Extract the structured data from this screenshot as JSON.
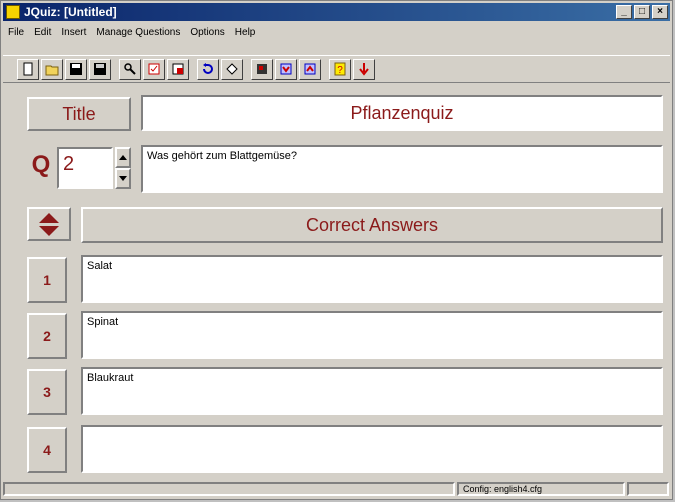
{
  "window": {
    "title": "JQuiz: [Untitled]"
  },
  "menu": [
    "File",
    "Edit",
    "Insert",
    "Manage Questions",
    "Options",
    "Help"
  ],
  "toolbar": {
    "buttons": [
      "new-icon",
      "open-icon",
      "save-icon",
      "save-as-icon",
      "find-icon",
      "check-icon",
      "export-icon",
      "undo-icon",
      "clear-icon",
      "settings-icon",
      "web-icon",
      "web-alt-icon",
      "help-icon",
      "quit-icon"
    ]
  },
  "title_label": "Title",
  "title_value": "Pflanzenquiz",
  "q_label": "Q",
  "question_number": "2",
  "question_text": "Was gehört zum Blattgemüse?",
  "answers_header": "Correct Answers",
  "answers": [
    {
      "num": "1",
      "text": "Salat"
    },
    {
      "num": "2",
      "text": "Spinat"
    },
    {
      "num": "3",
      "text": "Blaukraut"
    },
    {
      "num": "4",
      "text": ""
    }
  ],
  "status": {
    "config": "Config: english4.cfg"
  },
  "colors": {
    "accent": "#8b1a1a",
    "titlebar": "#0a246a"
  }
}
